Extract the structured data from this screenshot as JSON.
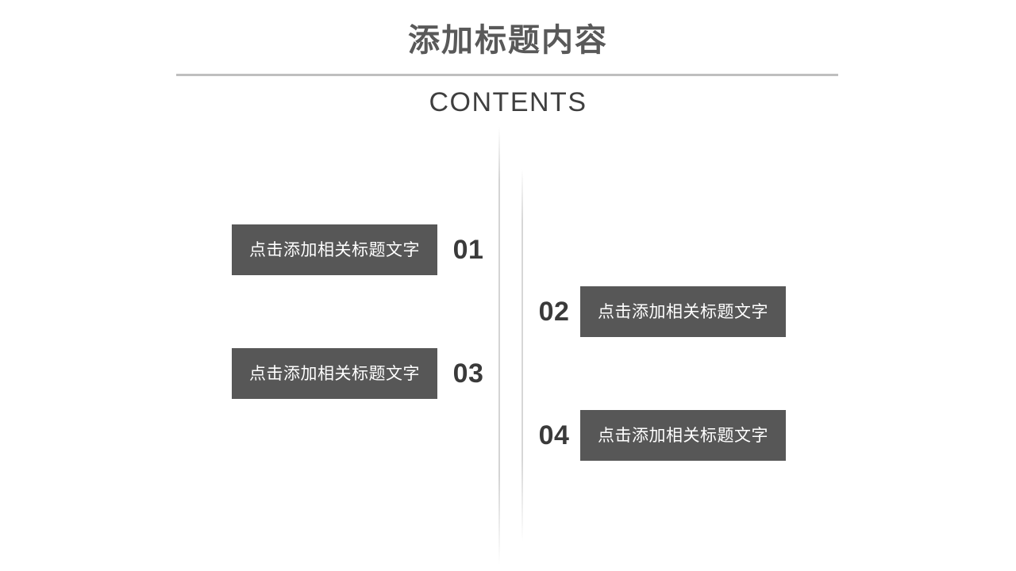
{
  "header": {
    "title": "添加标题内容",
    "subtitle": "CONTENTS"
  },
  "colors": {
    "background": "#ffffff",
    "title_text": "#595959",
    "rule": "#bfbfbf",
    "subtitle_text": "#3f3f3f",
    "box_fill": "#575757",
    "box_text": "#ffffff",
    "number_text": "#3a3a3a",
    "guide_line": "#cdcdcd"
  },
  "entries": [
    {
      "number": "01",
      "label": "点击添加相关标题文字",
      "side": "left"
    },
    {
      "number": "02",
      "label": "点击添加相关标题文字",
      "side": "right"
    },
    {
      "number": "03",
      "label": "点击添加相关标题文字",
      "side": "left"
    },
    {
      "number": "04",
      "label": "点击添加相关标题文字",
      "side": "right"
    }
  ]
}
